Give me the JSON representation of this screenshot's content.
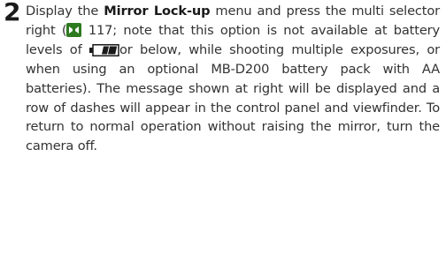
{
  "step": {
    "number": "2",
    "text_1": "Display the ",
    "menu_name": "Mirror Lock-up",
    "text_2": " menu and press the multi selector right (",
    "page_ref": "117",
    "text_3": "; note that this option is not available at battery levels of",
    "text_4": "or below, while shooting multiple exposures, or when using an optional MB-D200 battery pack with AA batteries). The message shown at right will be displayed and a row of dashes will appear in the control panel and viewfinder. To return to normal operation without raising the mirror, turn the camera off."
  },
  "icons": {
    "reference": "page-reference-icon",
    "battery": "battery-level-icon"
  },
  "colors": {
    "text": "#333333",
    "reference_icon": "#2d7a1f"
  }
}
